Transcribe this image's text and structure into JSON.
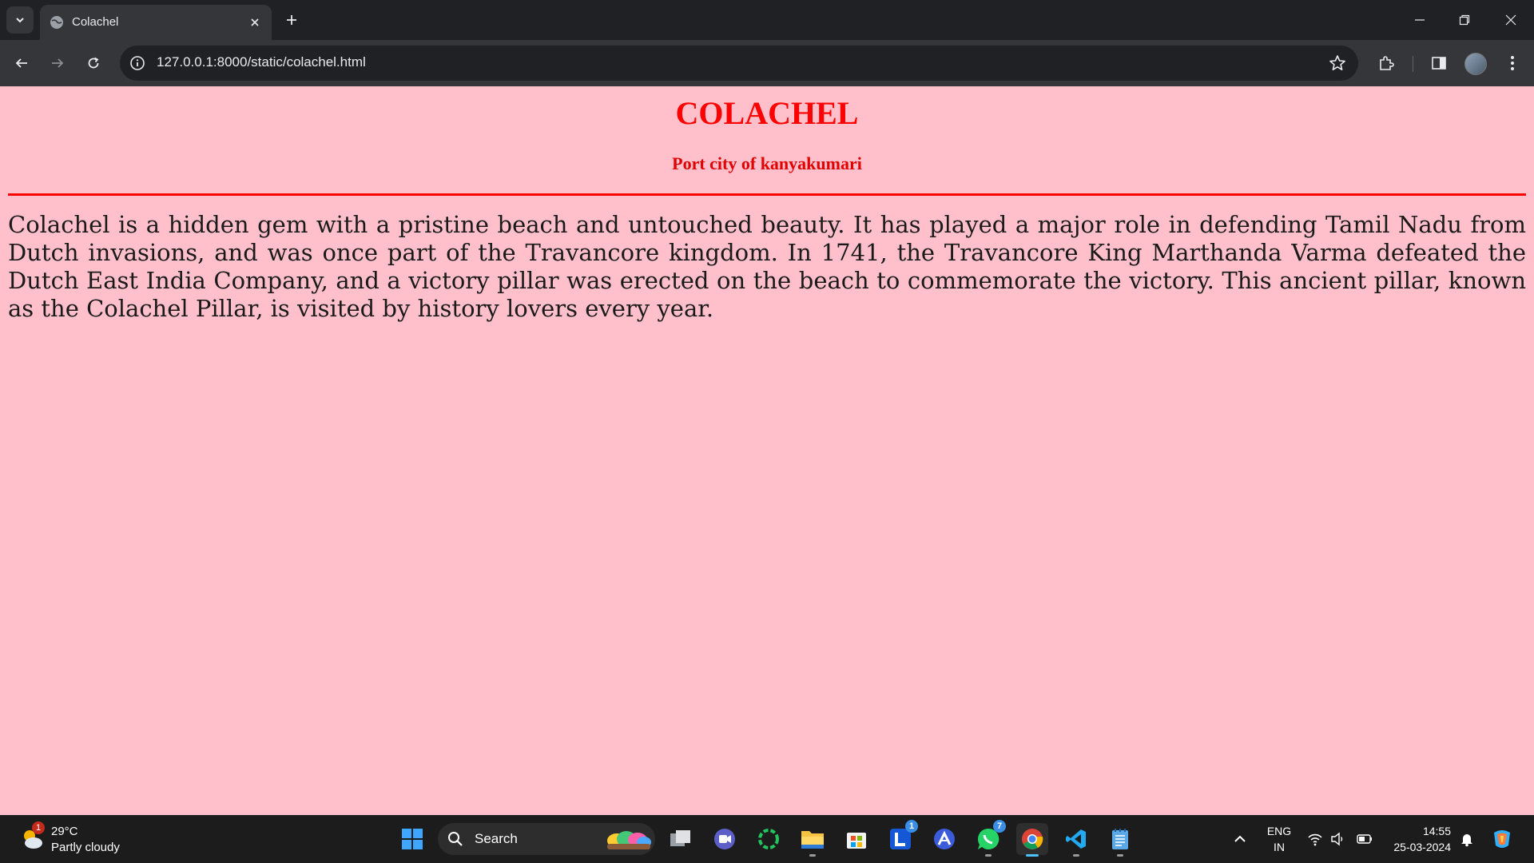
{
  "browser": {
    "tab_title": "Colachel",
    "url": "127.0.0.1:8000/static/colachel.html"
  },
  "page": {
    "title": "COLACHEL",
    "subtitle": "Port city of kanyakumari",
    "paragraph": "Colachel is a hidden gem with a pristine beach and untouched beauty. It has played a major role in defending Tamil Nadu from Dutch invasions, and was once part of the Travancore kingdom. In 1741, the Travancore King Marthanda Varma defeated the Dutch East India Company, and a victory pillar was erected on the beach to commemorate the victory. This ancient pillar, known as the Colachel Pillar, is visited by history lovers every year.",
    "background": "#ffc0cb",
    "accent": "#ff0000"
  },
  "taskbar": {
    "weather": {
      "temp": "29°C",
      "condition": "Partly cloudy",
      "badge": "1"
    },
    "search_label": "Search",
    "apps": [
      {
        "name": "start",
        "icon": "windows-icon"
      },
      {
        "name": "task-view",
        "icon": "task-view-icon"
      },
      {
        "name": "meet",
        "icon": "video-call-icon"
      },
      {
        "name": "ring-app",
        "icon": "ring-icon"
      },
      {
        "name": "file-explorer",
        "icon": "folder-icon"
      },
      {
        "name": "store",
        "icon": "store-icon"
      },
      {
        "name": "l-app",
        "icon": "l-app-icon",
        "badge": "1"
      },
      {
        "name": "arc-app",
        "icon": "triangle-app-icon"
      },
      {
        "name": "whatsapp",
        "icon": "whatsapp-icon",
        "badge": "7"
      },
      {
        "name": "chrome",
        "icon": "chrome-icon"
      },
      {
        "name": "vscode",
        "icon": "vscode-icon"
      },
      {
        "name": "notepad",
        "icon": "notepad-icon"
      }
    ],
    "lang_top": "ENG",
    "lang_bottom": "IN",
    "time": "14:55",
    "date": "25-03-2024"
  }
}
